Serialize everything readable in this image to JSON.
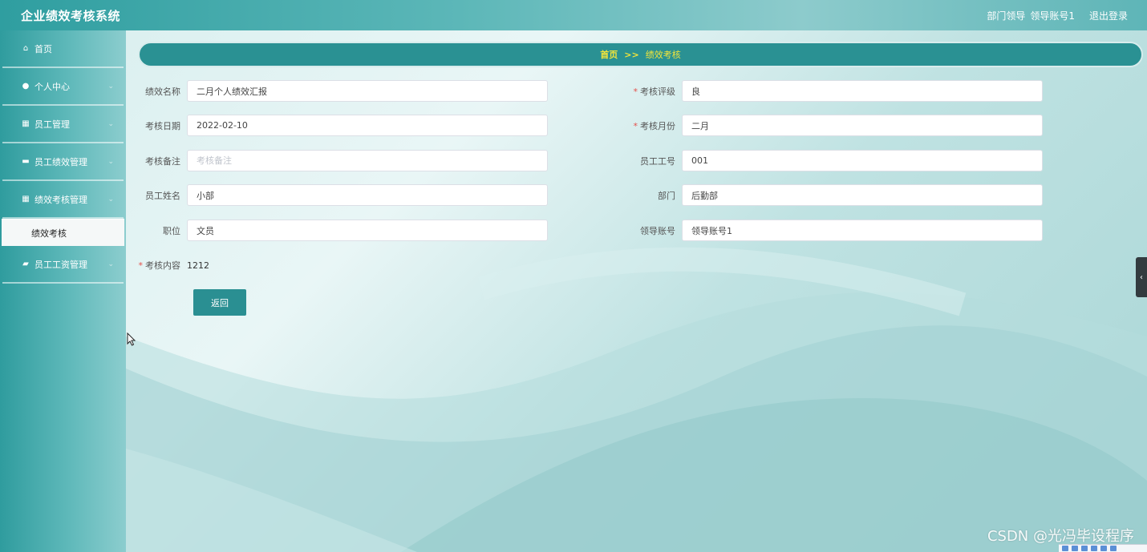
{
  "app": {
    "title": "企业绩效考核系统"
  },
  "header": {
    "role": "部门领导",
    "account": "领导账号1",
    "logout": "退出登录"
  },
  "sidebar": {
    "items": [
      {
        "label": "首页",
        "icon": "home-icon"
      },
      {
        "label": "个人中心",
        "icon": "user-icon"
      },
      {
        "label": "员工管理",
        "icon": "grid-icon"
      },
      {
        "label": "员工绩效管理",
        "icon": "chat-icon"
      },
      {
        "label": "绩效考核管理",
        "icon": "grid-icon"
      },
      {
        "label": "员工工资管理",
        "icon": "wallet-icon"
      }
    ],
    "subitem": {
      "label": "绩效考核"
    }
  },
  "breadcrumb": {
    "home": "首页",
    "sep": ">>",
    "current": "绩效考核"
  },
  "form": {
    "performance_name": {
      "label": "绩效名称",
      "value": "二月个人绩效汇报"
    },
    "rating": {
      "label": "考核评级",
      "value": "良"
    },
    "date": {
      "label": "考核日期",
      "value": "2022-02-10"
    },
    "month": {
      "label": "考核月份",
      "value": "二月"
    },
    "remark": {
      "label": "考核备注",
      "placeholder": "考核备注"
    },
    "employee_id": {
      "label": "员工工号",
      "value": "001"
    },
    "employee_name": {
      "label": "员工姓名",
      "value": "小部"
    },
    "department": {
      "label": "部门",
      "value": "后勤部"
    },
    "position": {
      "label": "职位",
      "value": "文员"
    },
    "leader_account": {
      "label": "领导账号",
      "value": "领导账号1"
    },
    "content": {
      "label": "考核内容",
      "value": "1212"
    },
    "required_mark": "*"
  },
  "buttons": {
    "back": "返回"
  },
  "watermark": "CSDN @光冯毕设程序",
  "colors": {
    "primary": "#2a9193",
    "breadcrumb_text": "#f2e53a",
    "required": "#e4504b"
  }
}
